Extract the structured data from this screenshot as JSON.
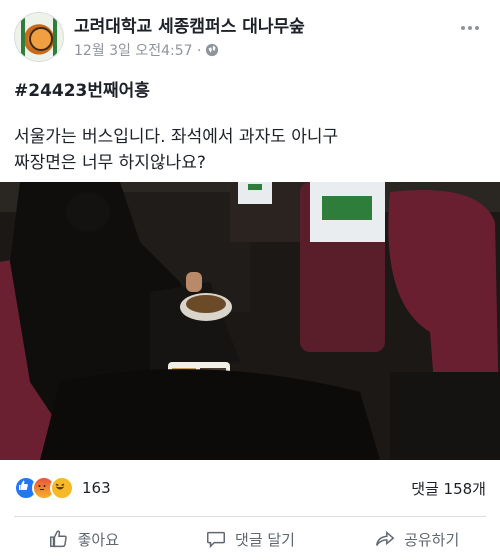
{
  "post": {
    "page_name": "고려대학교 세종캠퍼스 대나무숲",
    "timestamp": "12월 3일 오전4:57 ·",
    "hashtag": "#24423번째어흥",
    "body_lines": [
      "서울가는 버스입니다. 좌석에서 과자도 아니구",
      "짜장면은 너무 하지않나요?"
    ]
  },
  "icons": {
    "avatar": "tiger-bamboo-logo",
    "privacy": "globe-icon",
    "menu": "more-icon",
    "reactions": [
      "like-icon",
      "angry-icon",
      "haha-icon"
    ]
  },
  "photo": {
    "description_icon": "bus-seat-photo"
  },
  "stats": {
    "reactions_count": "163",
    "comments_label": "댓글 158개"
  },
  "actions": {
    "like": "좋아요",
    "comment": "댓글 달기",
    "share": "공유하기"
  },
  "colors": {
    "accent": "#2078f4",
    "muted": "#90949c",
    "text": "#1d2129"
  }
}
